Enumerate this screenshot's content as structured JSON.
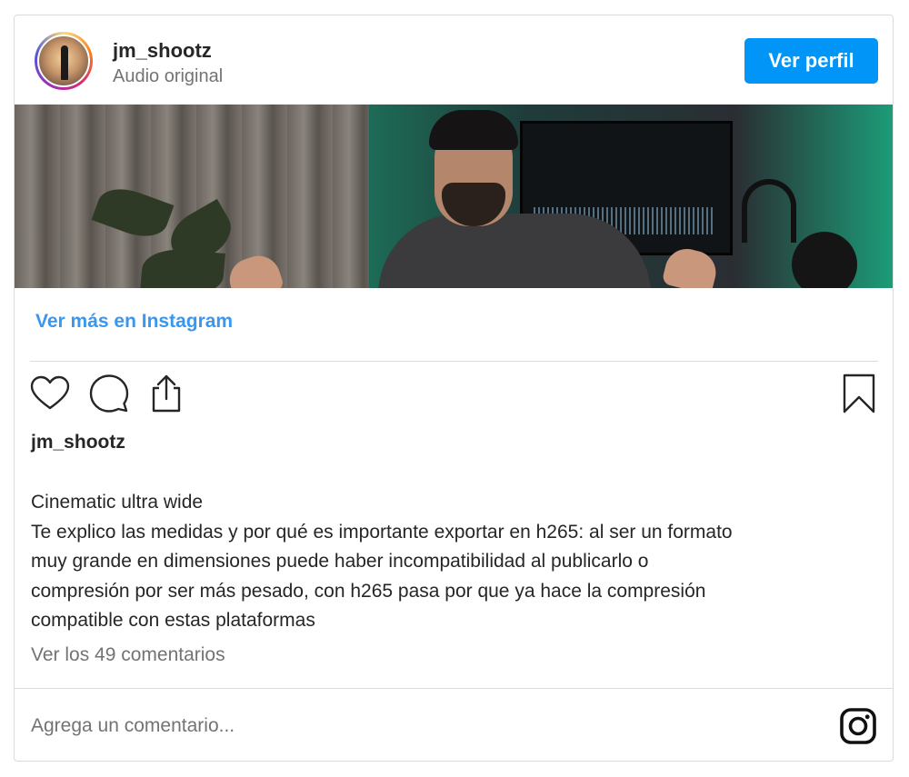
{
  "header": {
    "username": "jm_shootz",
    "subtitle": "Audio original",
    "profile_button": "Ver perfil"
  },
  "media": {
    "avatar_icon": "profile-photo",
    "content": "video-frame"
  },
  "more_link": "Ver más en Instagram",
  "actions": {
    "like_icon": "heart-icon",
    "comment_icon": "comment-icon",
    "share_icon": "share-icon",
    "save_icon": "bookmark-icon"
  },
  "post": {
    "owner": "jm_shootz",
    "caption_lines": [
      "Cinematic ultra wide",
      "Te explico las medidas y por qué es importante exportar en h265: al ser un formato",
      "muy grande en dimensiones puede haber incompatibilidad al publicarlo o",
      "compresión por ser más pesado, con h265 pasa por que ya hace la compresión",
      "compatible con estas plataformas"
    ],
    "comments_link": "Ver los 49 comentarios"
  },
  "comment_box": {
    "placeholder": "Agrega un comentario..."
  },
  "colors": {
    "accent": "#0095f6",
    "link": "#3897f0",
    "border": "#dbdbdb",
    "muted": "#737373"
  }
}
